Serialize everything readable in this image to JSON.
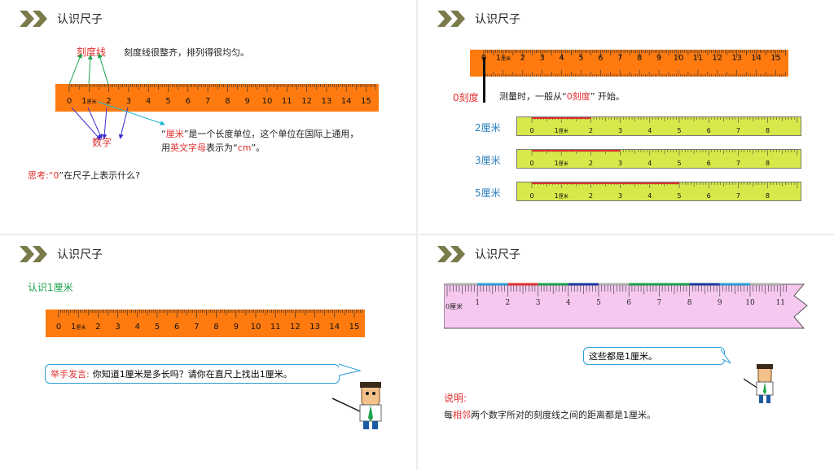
{
  "slide_title": "认识尺子",
  "ruler_numbers": [
    "0",
    "1",
    "2",
    "3",
    "4",
    "5",
    "6",
    "7",
    "8",
    "9",
    "10",
    "11",
    "12",
    "13",
    "14",
    "15"
  ],
  "ruler_unit": "厘米",
  "slide1": {
    "label_tick": "刻度线",
    "label_tick_desc": "刻度线很整齐，排列得很均匀。",
    "label_number": "数字",
    "cm_q1": "“",
    "cm_word": "厘米",
    "cm_q2": "”是一个长度单位，这个单位在国际上通用，",
    "cm_line2a": "用",
    "cm_line2b": "英文字母",
    "cm_line2c": "表示为“",
    "cm_line2d": "cm",
    "cm_line2e": "”。",
    "think_a": "思考:“",
    "think_b": "0",
    "think_c": "”在尺子上表示什么?"
  },
  "slide2": {
    "zero_label": "0刻度",
    "measure_a": "测量时，一般从“",
    "measure_b": "0刻度",
    "measure_c": "” 开始。",
    "green_numbers": [
      "0",
      "1",
      "2",
      "3",
      "4",
      "5",
      "6",
      "7",
      "8"
    ],
    "rows": [
      {
        "label": "2厘米",
        "cm": 2
      },
      {
        "label": "3厘米",
        "cm": 3
      },
      {
        "label": "5厘米",
        "cm": 5
      }
    ]
  },
  "slide3": {
    "subtitle": "认识1厘米",
    "ask_a": "举手发言:",
    "ask_b": "你知道1厘米是多长吗？请你在直尺上找出1厘米。"
  },
  "slide4": {
    "pink_numbers": [
      "1",
      "2",
      "3",
      "4",
      "5",
      "6",
      "7",
      "8",
      "9",
      "10",
      "11"
    ],
    "pink_zero": "0厘米",
    "bubble": "这些都是1厘米。",
    "note_title": "说明:",
    "note_a": "每",
    "note_b": "相邻",
    "note_c": "两个数字所对的刻度线之间的距离都是1厘米。"
  },
  "colors": {
    "orange_ruler": "#ff7b0f",
    "green_ruler": "#d7e84a",
    "pink_ruler": "#f6c8f0",
    "chevron": "#7a7a4a"
  }
}
